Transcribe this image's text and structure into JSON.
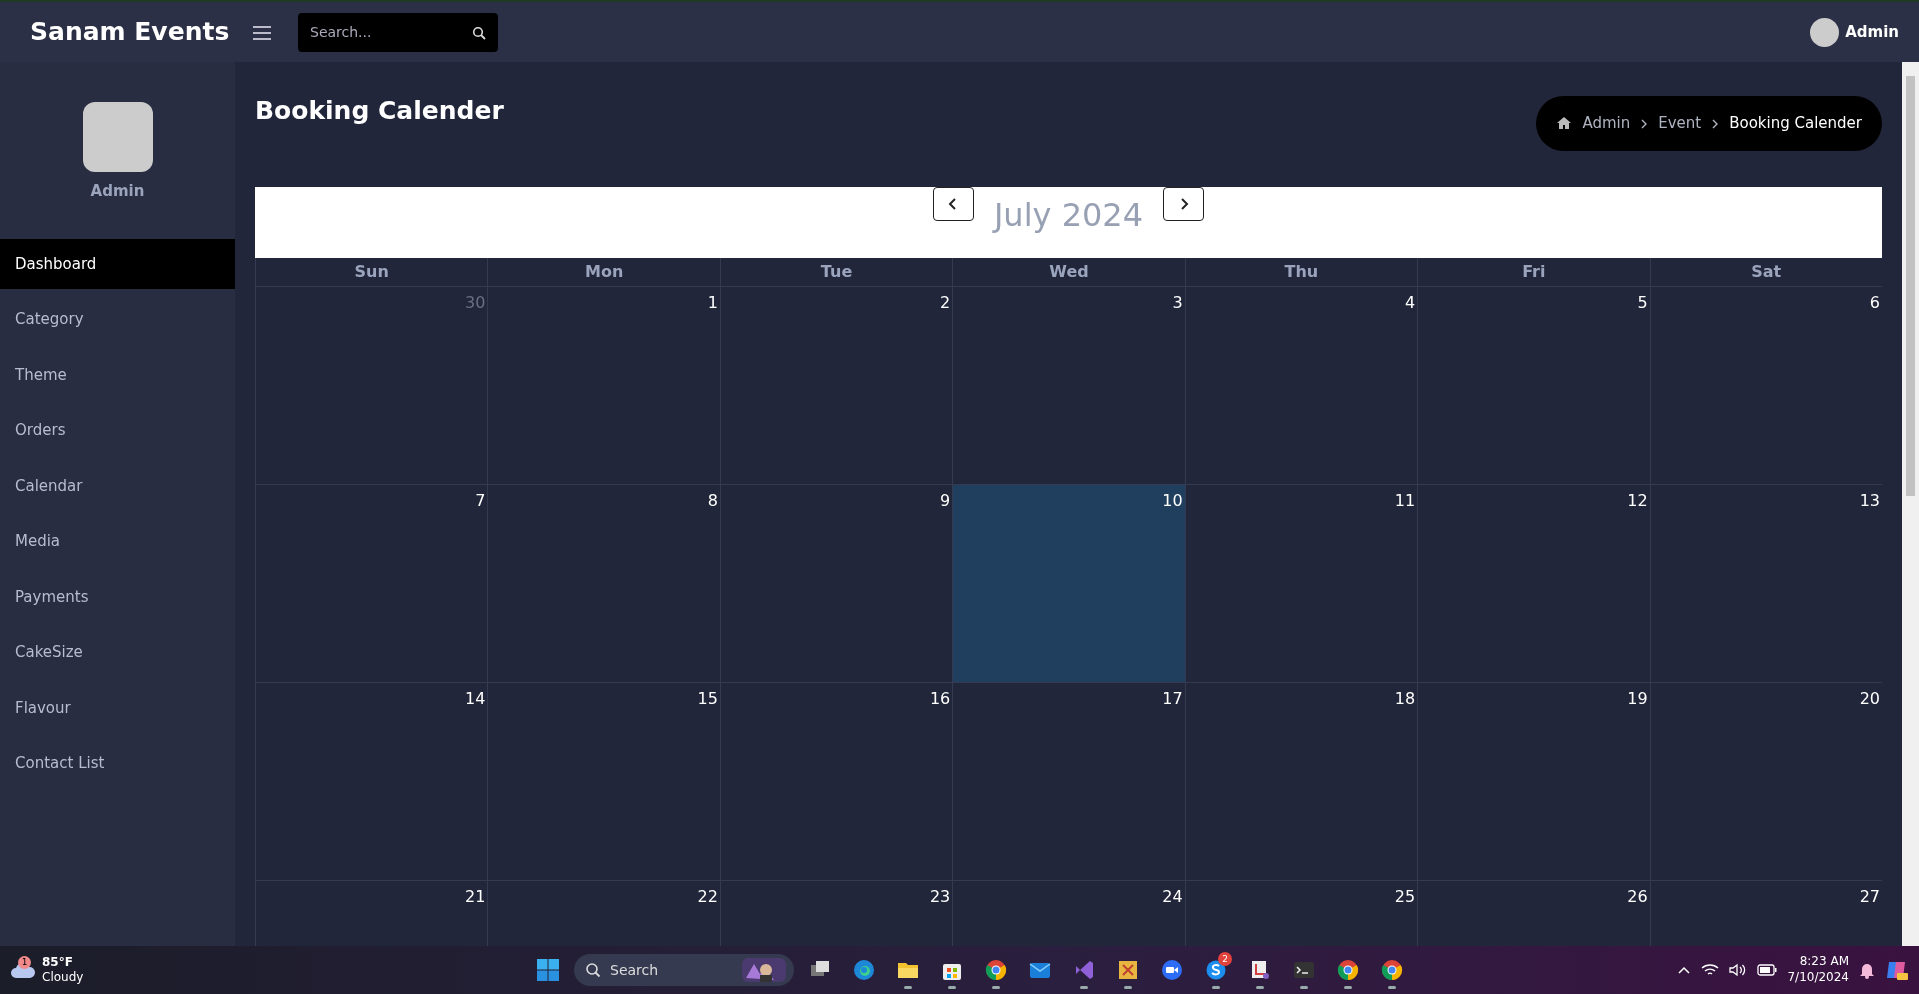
{
  "topbar": {
    "brand": "Sanam Events",
    "search": {
      "placeholder": "Search..."
    },
    "user": {
      "name": "Admin"
    }
  },
  "sidebar": {
    "profile_name": "Admin",
    "items": [
      {
        "label": "Dashboard",
        "selected": true
      },
      {
        "label": "Category",
        "selected": false
      },
      {
        "label": "Theme",
        "selected": false
      },
      {
        "label": "Orders",
        "selected": false
      },
      {
        "label": "Calendar",
        "selected": false
      },
      {
        "label": "Media",
        "selected": false
      },
      {
        "label": "Payments",
        "selected": false
      },
      {
        "label": "CakeSize",
        "selected": false
      },
      {
        "label": "Flavour",
        "selected": false
      },
      {
        "label": "Contact List",
        "selected": false
      }
    ]
  },
  "page": {
    "title": "Booking Calender",
    "breadcrumb": [
      {
        "label": "Admin",
        "current": false
      },
      {
        "label": "Event",
        "current": false
      },
      {
        "label": "Booking Calender",
        "current": true
      }
    ]
  },
  "calendar": {
    "month": "July 2024",
    "weekdays": [
      "Sun",
      "Mon",
      "Tue",
      "Wed",
      "Thu",
      "Fri",
      "Sat"
    ],
    "weeks": [
      [
        {
          "day": "30",
          "outside": true,
          "today": false
        },
        {
          "day": "1",
          "outside": false,
          "today": false
        },
        {
          "day": "2",
          "outside": false,
          "today": false
        },
        {
          "day": "3",
          "outside": false,
          "today": false
        },
        {
          "day": "4",
          "outside": false,
          "today": false
        },
        {
          "day": "5",
          "outside": false,
          "today": false
        },
        {
          "day": "6",
          "outside": false,
          "today": false
        }
      ],
      [
        {
          "day": "7",
          "outside": false,
          "today": false
        },
        {
          "day": "8",
          "outside": false,
          "today": false
        },
        {
          "day": "9",
          "outside": false,
          "today": false
        },
        {
          "day": "10",
          "outside": false,
          "today": true
        },
        {
          "day": "11",
          "outside": false,
          "today": false
        },
        {
          "day": "12",
          "outside": false,
          "today": false
        },
        {
          "day": "13",
          "outside": false,
          "today": false
        }
      ],
      [
        {
          "day": "14",
          "outside": false,
          "today": false
        },
        {
          "day": "15",
          "outside": false,
          "today": false
        },
        {
          "day": "16",
          "outside": false,
          "today": false
        },
        {
          "day": "17",
          "outside": false,
          "today": false
        },
        {
          "day": "18",
          "outside": false,
          "today": false
        },
        {
          "day": "19",
          "outside": false,
          "today": false
        },
        {
          "day": "20",
          "outside": false,
          "today": false
        }
      ],
      [
        {
          "day": "21",
          "outside": false,
          "today": false
        },
        {
          "day": "22",
          "outside": false,
          "today": false
        },
        {
          "day": "23",
          "outside": false,
          "today": false
        },
        {
          "day": "24",
          "outside": false,
          "today": false
        },
        {
          "day": "25",
          "outside": false,
          "today": false
        },
        {
          "day": "26",
          "outside": false,
          "today": false
        },
        {
          "day": "27",
          "outside": false,
          "today": false
        }
      ]
    ]
  },
  "taskbar": {
    "weather": {
      "badge": "1",
      "temperature": "85°F",
      "condition": "Cloudy"
    },
    "search": {
      "placeholder": "Search"
    },
    "apps": [
      {
        "kind": "taskview",
        "running": false
      },
      {
        "kind": "edge",
        "running": false
      },
      {
        "kind": "folder",
        "running": true
      },
      {
        "kind": "store",
        "running": true
      },
      {
        "kind": "chrome",
        "running": true
      },
      {
        "kind": "mail",
        "running": false
      },
      {
        "kind": "studio",
        "running": true
      },
      {
        "kind": "tool",
        "running": true
      },
      {
        "kind": "zoom",
        "running": false
      },
      {
        "kind": "skype",
        "running": true,
        "badge": "2"
      },
      {
        "kind": "snip",
        "running": true
      },
      {
        "kind": "terminal",
        "running": true
      },
      {
        "kind": "chrome",
        "running": true
      },
      {
        "kind": "chrome",
        "running": true
      }
    ],
    "time": "8:23 AM",
    "date": "7/10/2024"
  }
}
